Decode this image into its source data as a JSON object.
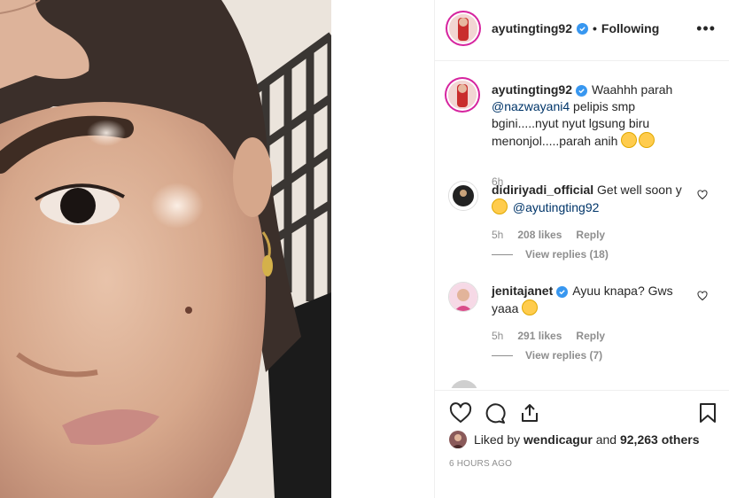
{
  "post": {
    "author": "ayutingting92",
    "follow_status": "Following",
    "separator": "•",
    "more_icon": "more-horizontal-icon"
  },
  "caption": {
    "username": "ayutingting92",
    "text_1": "Waahhh parah ",
    "mention": "@nazwayani4",
    "text_2": " pelipis smp bgini.....nyut nyut lgsung biru menonjol.....parah anih ",
    "time": "6h"
  },
  "comments": [
    {
      "username": "didiriyadi_official",
      "text": "Get well soon y ",
      "mention": "@ayutingting92",
      "time": "5h",
      "likes": "208 likes",
      "reply_label": "Reply",
      "view_replies": "View replies (18)"
    },
    {
      "username": "jenitajanet",
      "text": "Ayuu knapa? Gws yaaa ",
      "time": "5h",
      "likes": "291 likes",
      "reply_label": "Reply",
      "view_replies": "View replies (7)"
    }
  ],
  "likes": {
    "prefix": "Liked by ",
    "user": "wendicagur",
    "middle": " and ",
    "count": "92,263 others"
  },
  "timestamp": "6 HOURS AGO",
  "colors": {
    "verified": "#3897f0",
    "mention": "#003569",
    "muted": "#8e8e8e",
    "ring": "#d6249f"
  }
}
